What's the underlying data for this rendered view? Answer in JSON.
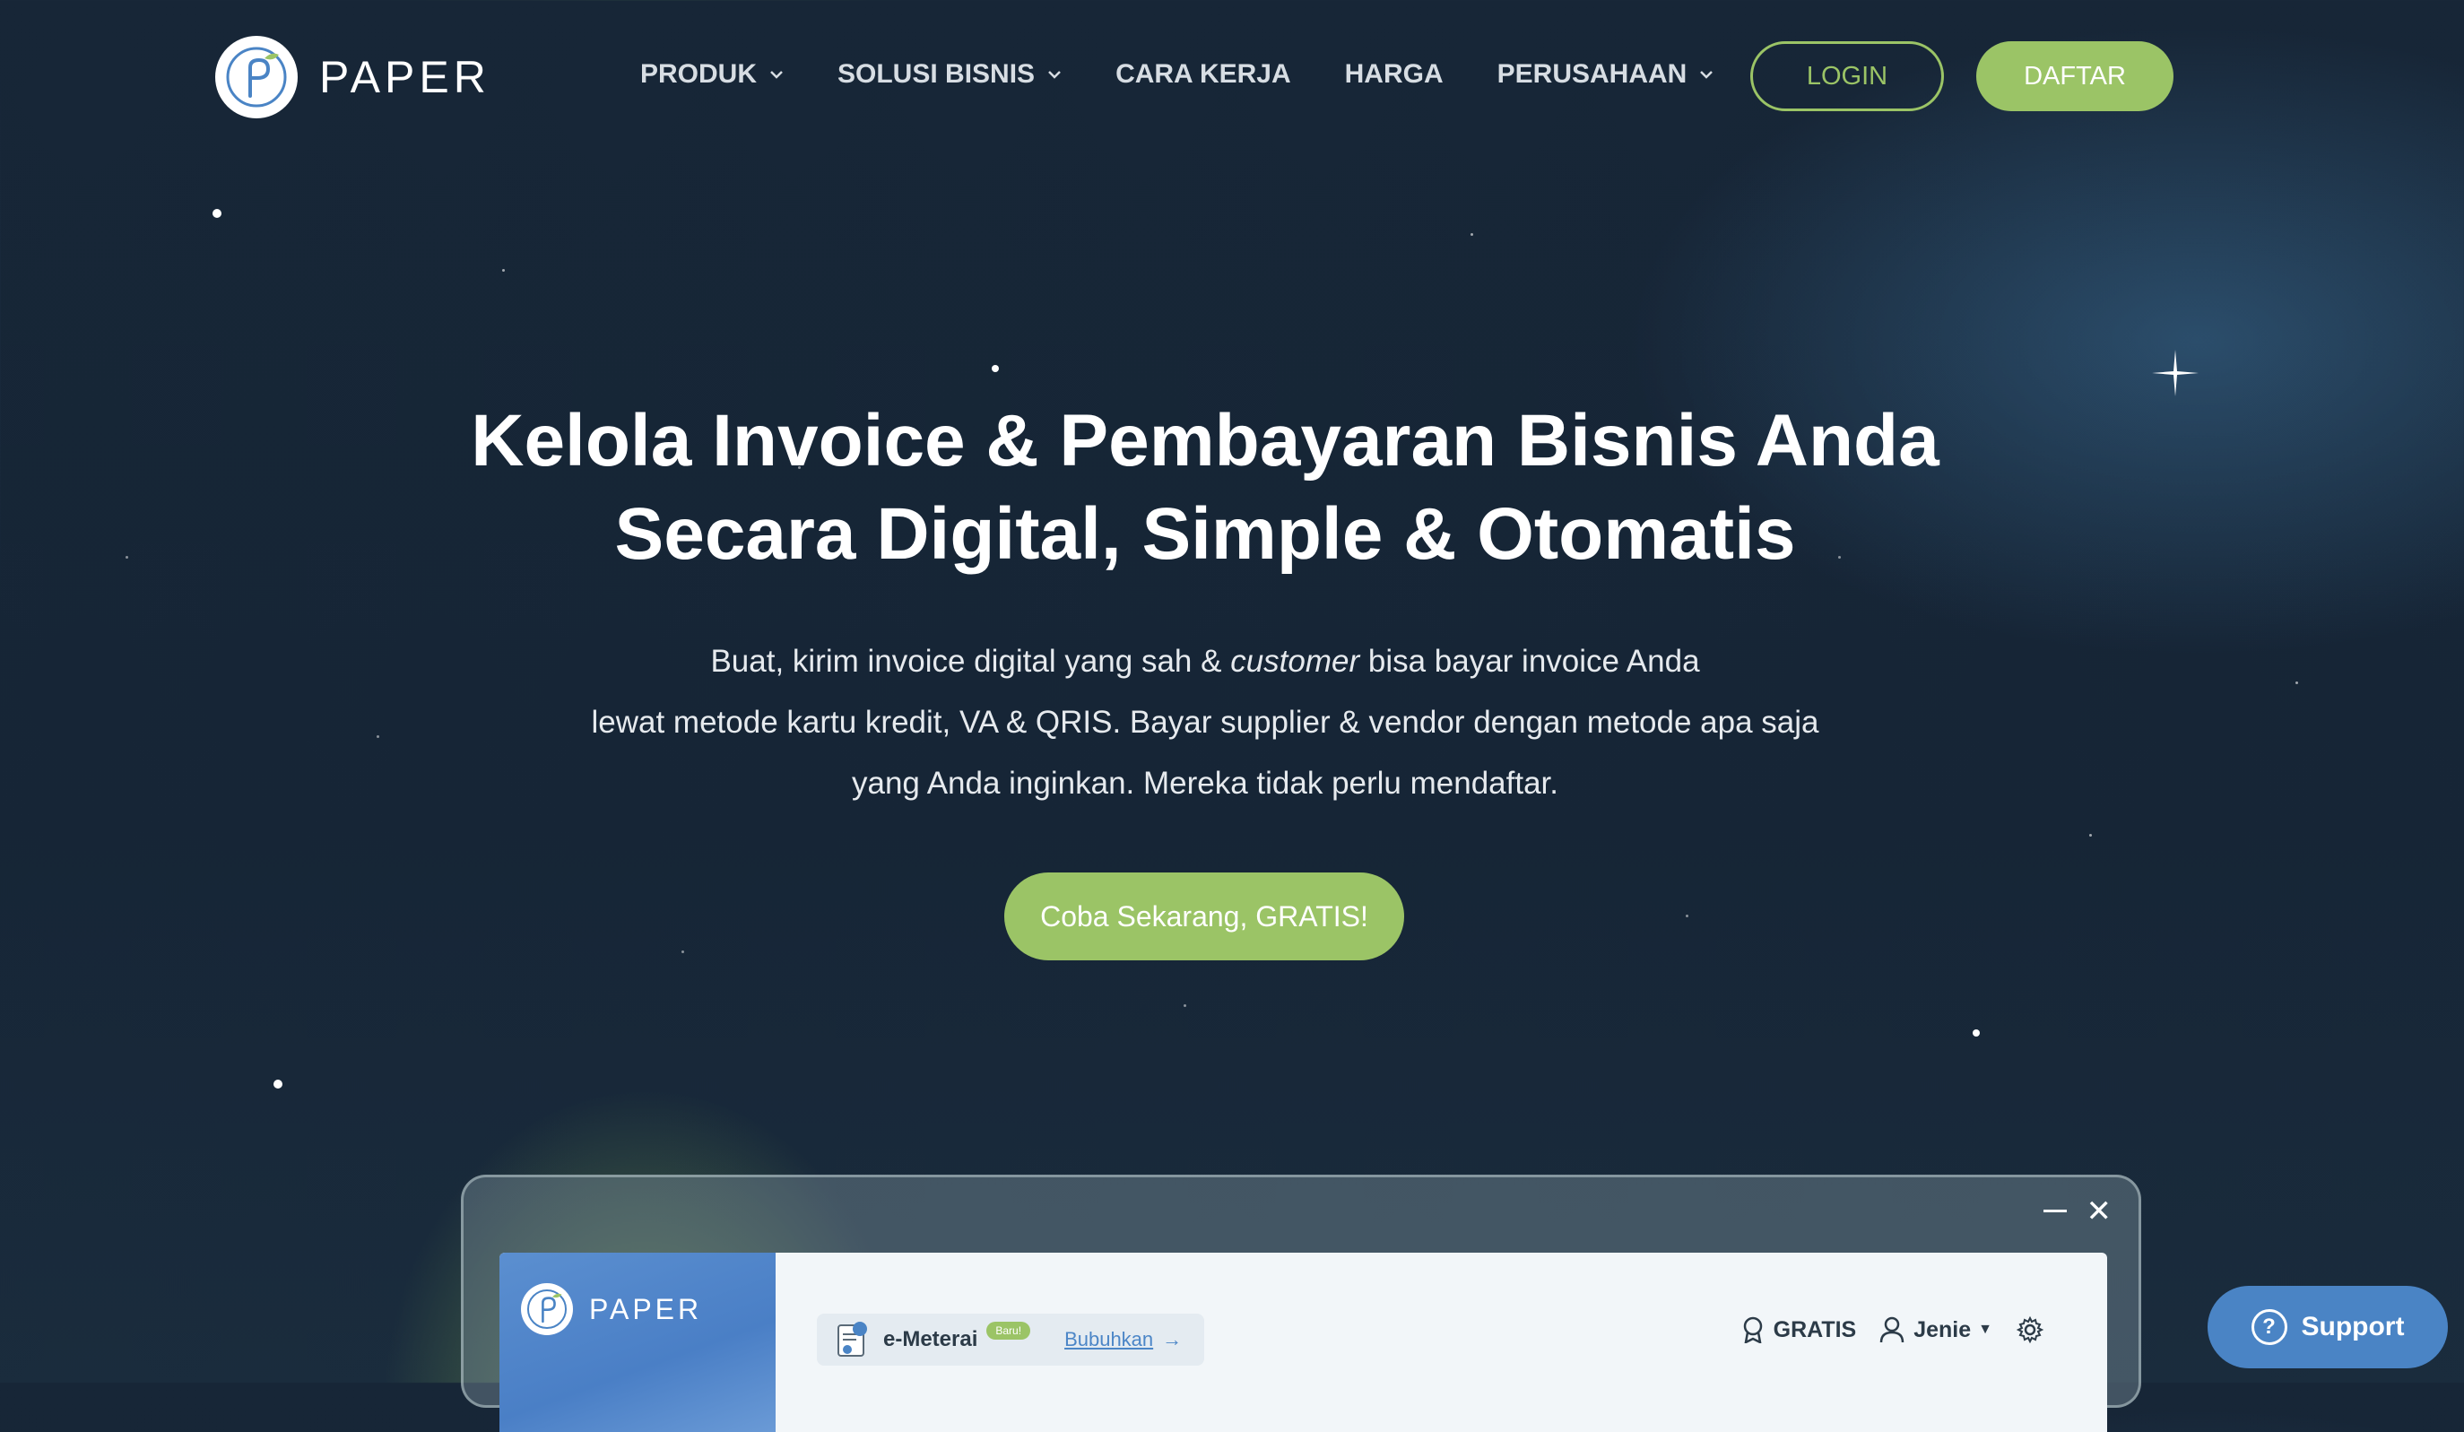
{
  "brand": {
    "name": "PAPER",
    "accent": "#9bc466",
    "background": "#172637"
  },
  "nav": {
    "items": [
      {
        "label": "PRODUK",
        "dropdown": true
      },
      {
        "label": "SOLUSI BISNIS",
        "dropdown": true
      },
      {
        "label": "CARA KERJA",
        "dropdown": false
      },
      {
        "label": "HARGA",
        "dropdown": false
      },
      {
        "label": "PERUSAHAAN",
        "dropdown": true
      }
    ],
    "login_label": "LOGIN",
    "register_label": "DAFTAR"
  },
  "hero": {
    "title_line1": "Kelola Invoice & Pembayaran Bisnis Anda",
    "title_line2": "Secara Digital, Simple & Otomatis",
    "sub_line1_a": "Buat, kirim invoice digital yang sah & ",
    "sub_line1_em": "customer",
    "sub_line1_b": " bisa bayar invoice Anda",
    "sub_line2": "lewat metode kartu kredit, VA & QRIS. Bayar supplier & vendor dengan metode apa saja",
    "sub_line3": "yang Anda inginkan. Mereka tidak perlu mendaftar.",
    "cta_label": "Coba Sekarang, GRATIS!"
  },
  "app_preview": {
    "brand": "PAPER",
    "emeterai_label": "e-Meterai",
    "emeterai_badge": "Baru!",
    "emeterai_action": "Bubuhkan",
    "plan_label": "GRATIS",
    "user_name": "Jenie"
  },
  "support": {
    "label": "Support"
  }
}
